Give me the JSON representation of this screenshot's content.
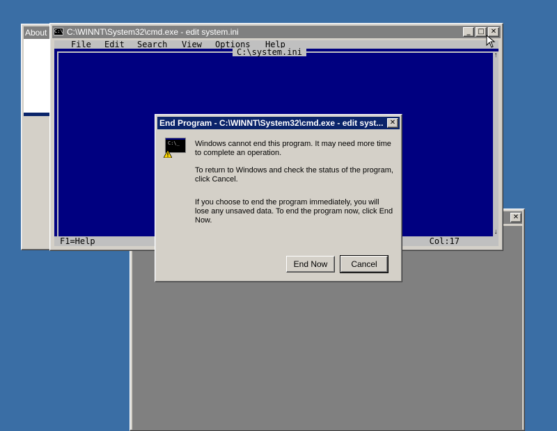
{
  "about_window": {
    "title": "About"
  },
  "cmd_window": {
    "title": "C:\\WINNT\\System32\\cmd.exe - edit system.ini",
    "icon": "cmd-icon",
    "menu": [
      "File",
      "Edit",
      "Search",
      "View",
      "Options",
      "Help"
    ],
    "doc_caption": "C:\\system.ini",
    "status_left": "F1=Help",
    "status_right": "Col:17"
  },
  "dialog": {
    "title": "End Program - C:\\WINNT\\System32\\cmd.exe - edit syst...",
    "paragraph1": "Windows cannot end this program. It may need more time to complete an operation.",
    "paragraph2": "To return to Windows and check the status of the program, click Cancel.",
    "paragraph3": "If you choose to end the program immediately, you will lose any unsaved data. To end the program now, click End Now.",
    "end_now_label": "End Now",
    "cancel_label": "Cancel",
    "icon_text": "C:\\_"
  },
  "colors": {
    "desktop": "#3a6ea5",
    "title_active": "#0a246a",
    "dos_background": "#000080",
    "window_face": "#d4d0c8"
  }
}
